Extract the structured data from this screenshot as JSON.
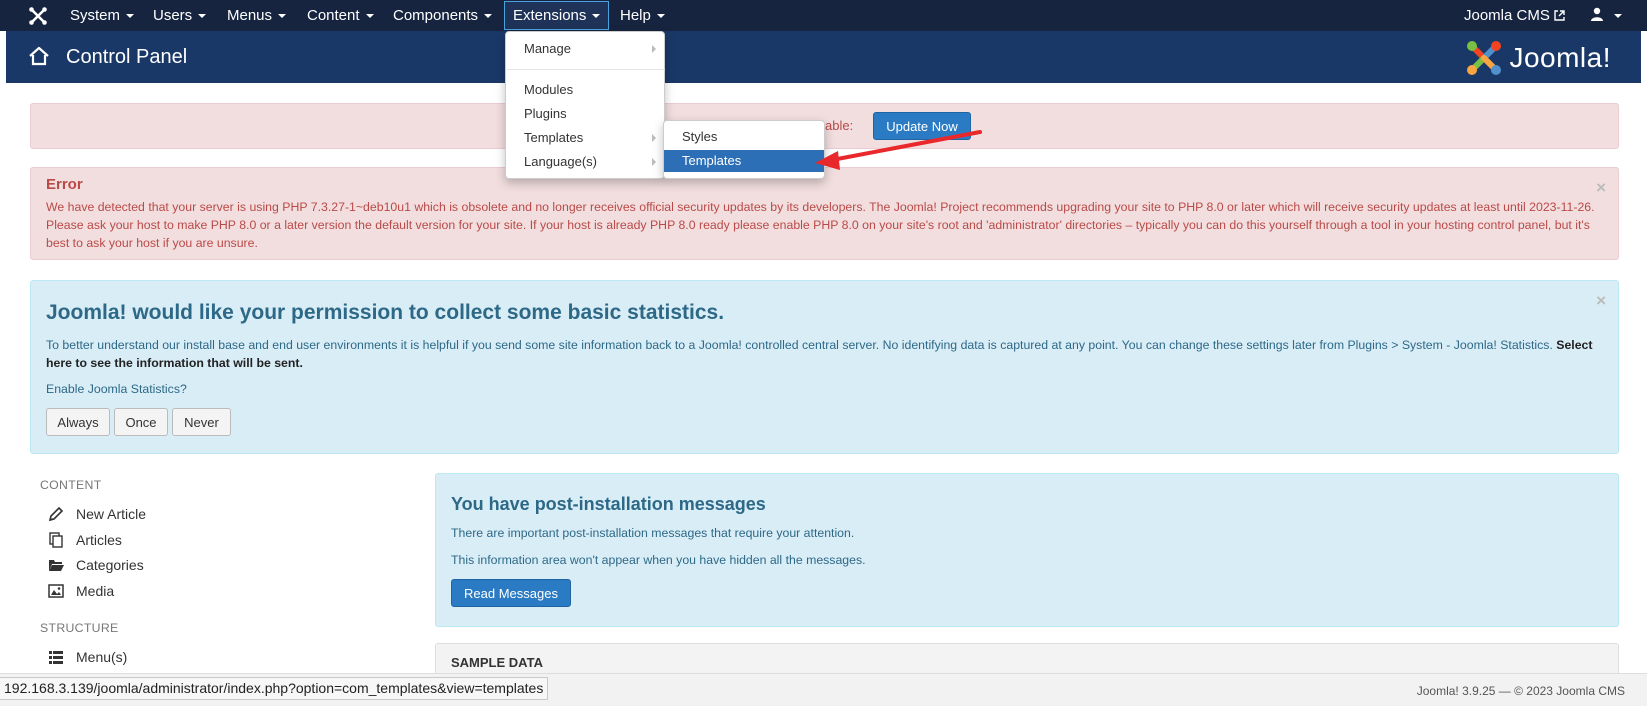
{
  "navbar": {
    "menus": [
      "System",
      "Users",
      "Menus",
      "Content",
      "Components",
      "Extensions",
      "Help"
    ],
    "site_link": "Joomla CMS",
    "icons": [
      "joomla-logo-icon",
      "external-link-icon",
      "user-icon"
    ]
  },
  "header": {
    "title": "Control Panel",
    "brand": "Joomla!"
  },
  "update_alert": {
    "text_fragment": "able:",
    "button": "Update Now"
  },
  "error_alert": {
    "heading": "Error",
    "message": "We have detected that your server is using PHP 7.3.27-1~deb10u1 which is obsolete and no longer receives official security updates by its developers. The Joomla! Project recommends upgrading your site to PHP 8.0 or later which will receive security updates at least until 2023-11-26. Please ask your host to make PHP 8.0 or a later version the default version for your site. If your host is already PHP 8.0 ready please enable PHP 8.0 on your site's root and 'administrator' directories – typically you can do this yourself through a tool in your hosting control panel, but it's best to ask your host if you are unsure."
  },
  "stats_alert": {
    "heading": "Joomla! would like your permission to collect some basic statistics.",
    "message": "To better understand our install base and end user environments it is helpful if you send some site information back to a Joomla! controlled central server. No identifying data is captured at any point. You can change these settings later from Plugins > System - Joomla! Statistics.",
    "message_link": "Select here to see the information that will be sent.",
    "question": "Enable Joomla Statistics?",
    "buttons": [
      "Always",
      "Once",
      "Never"
    ]
  },
  "sidebar": {
    "content_heading": "CONTENT",
    "content_items": [
      "New Article",
      "Articles",
      "Categories",
      "Media"
    ],
    "structure_heading": "STRUCTURE",
    "structure_items": [
      "Menu(s)"
    ]
  },
  "post_install": {
    "heading": "You have post-installation messages",
    "line1": "There are important post-installation messages that require your attention.",
    "line2": "This information area won't appear when you have hidden all the messages.",
    "button": "Read Messages"
  },
  "sample_data": {
    "heading": "SAMPLE DATA"
  },
  "footer": {
    "version": "Joomla! 3.9.25  —  © 2023 Joomla CMS",
    "status_url": "192.168.3.139/joomla/administrator/index.php?option=com_templates&view=templates"
  },
  "extensions_menu": {
    "items": [
      "Manage",
      "Modules",
      "Plugins",
      "Templates",
      "Language(s)"
    ]
  },
  "templates_submenu": {
    "items": [
      "Styles",
      "Templates"
    ],
    "highlighted": "Templates"
  },
  "annotation": {
    "color": "#e8282b"
  }
}
